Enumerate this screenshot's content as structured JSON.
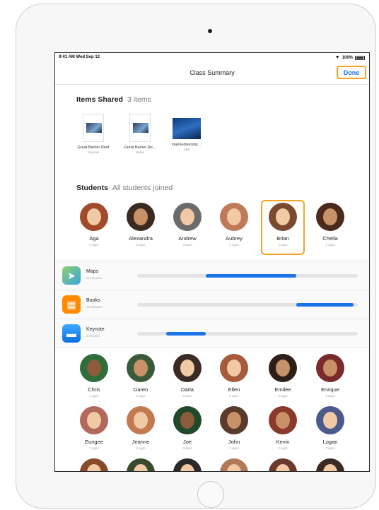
{
  "status_bar": {
    "time": "9:41 AM  Wed Sep 12",
    "battery": "100%"
  },
  "nav": {
    "title": "Class Summary",
    "done_label": "Done"
  },
  "items_shared": {
    "title": "Items Shared",
    "count": "3 items",
    "documents": [
      {
        "name": "Great Barrier Reef",
        "app": "Keynote"
      },
      {
        "name": "Great Barrier Re...",
        "app": "Notes"
      },
      {
        "name": "marinediversity....",
        "app": "Aga"
      }
    ]
  },
  "students_section": {
    "title": "Students",
    "status": "All students joined",
    "students": [
      {
        "name": "Aga",
        "sub": "3 apps"
      },
      {
        "name": "Alexandra",
        "sub": "3 apps"
      },
      {
        "name": "Andrew",
        "sub": "3 apps"
      },
      {
        "name": "Aubrey",
        "sub": "3 apps"
      },
      {
        "name": "Brian",
        "sub": "3 apps"
      },
      {
        "name": "Chella",
        "sub": "3 apps"
      }
    ]
  },
  "apps": [
    {
      "name": "Maps",
      "time": "21 minutes",
      "icon": "maps-icon",
      "color": "#34c759",
      "progress_start": 0.31,
      "progress_end": 0.72
    },
    {
      "name": "Books",
      "time": "14 minutes",
      "icon": "books-icon",
      "color": "#ff9500",
      "progress_start": 0.72,
      "progress_end": 0.98
    },
    {
      "name": "Keynote",
      "time": "8 minutes",
      "icon": "keynote-icon",
      "color": "#1a8cff",
      "progress_start": 0.13,
      "progress_end": 0.31
    }
  ],
  "student_grid": [
    {
      "name": "Chris",
      "sub": "3 apps"
    },
    {
      "name": "Daren",
      "sub": "4 apps"
    },
    {
      "name": "Darla",
      "sub": "3 apps"
    },
    {
      "name": "Ellen",
      "sub": "3 apps"
    },
    {
      "name": "Emilee",
      "sub": "3 apps"
    },
    {
      "name": "Enrique",
      "sub": "3 apps"
    },
    {
      "name": "Eungee",
      "sub": "3 apps"
    },
    {
      "name": "Jeanne",
      "sub": "3 apps"
    },
    {
      "name": "Joe",
      "sub": "3 apps"
    },
    {
      "name": "John",
      "sub": "3 apps"
    },
    {
      "name": "Kevin",
      "sub": "3 apps"
    },
    {
      "name": "Logan",
      "sub": "3 apps"
    }
  ],
  "colors": {
    "accent": "#1a73e8",
    "highlight": "#f5a623"
  }
}
